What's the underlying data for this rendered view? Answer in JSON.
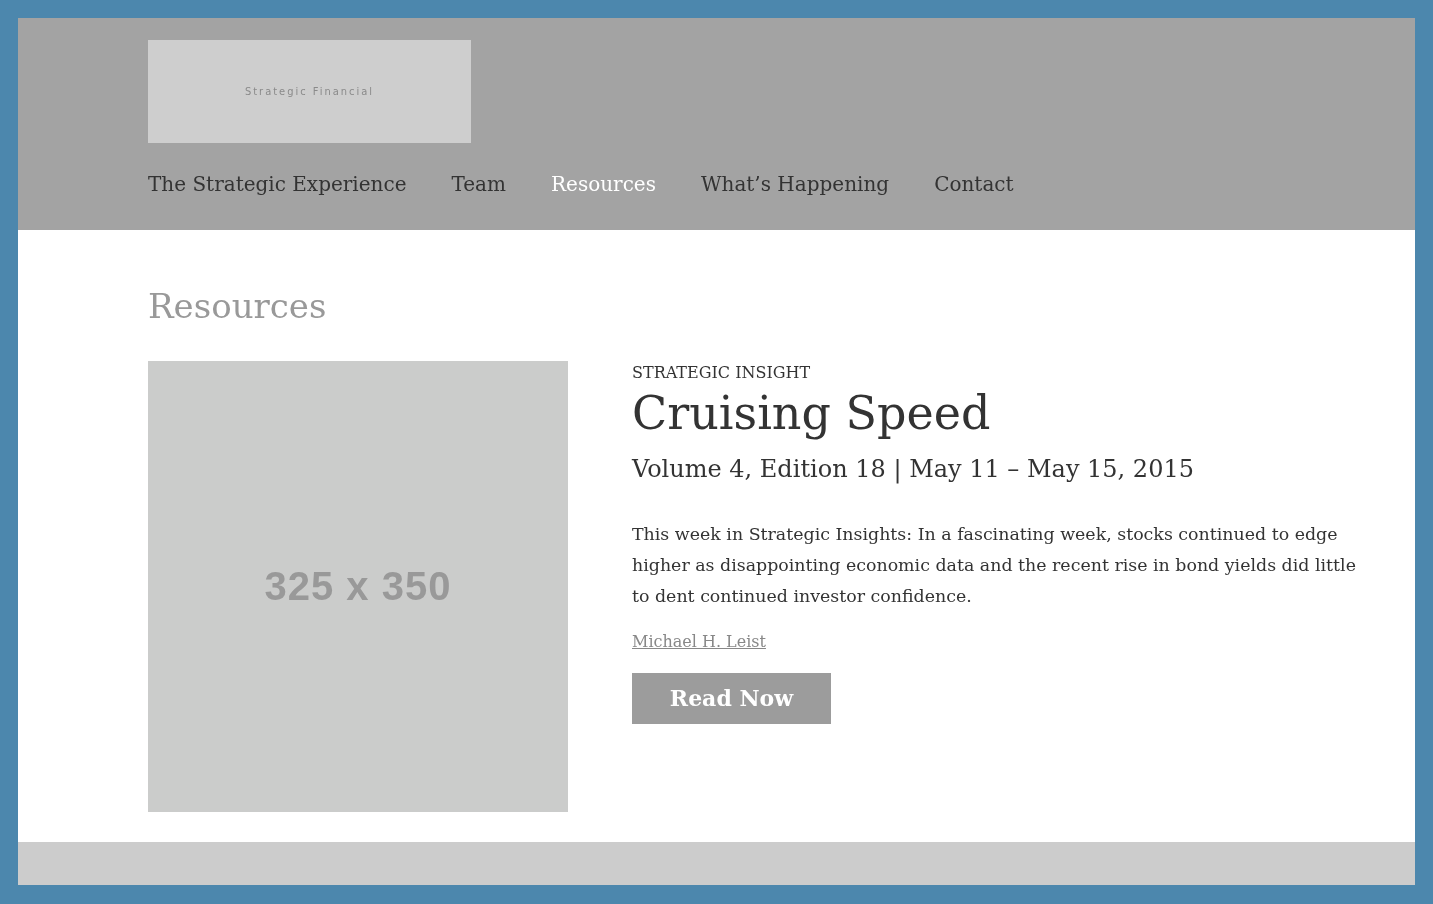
{
  "header": {
    "logo": "Strategic Financial",
    "nav": [
      {
        "label": "The Strategic Experience",
        "selected": false
      },
      {
        "label": "Team",
        "selected": false
      },
      {
        "label": "Resources",
        "selected": true
      },
      {
        "label": "What’s Happening",
        "selected": false
      },
      {
        "label": "Contact",
        "selected": false
      }
    ]
  },
  "page_title": "Resources",
  "article": {
    "image_placeholder": "325 x 350",
    "category": "STRATEGIC INSIGHT",
    "title": "Cruising Speed",
    "subtitle": "Volume 4, Edition 18 | May 11 – May 15, 2015",
    "summary": "This week in Strategic Insights: In a fascinating week, stocks continued to edge higher as disappointing economic data and the recent rise in bond yields did little to dent continued investor confidence.",
    "author": "Michael H. Leist",
    "button": "Read Now"
  }
}
